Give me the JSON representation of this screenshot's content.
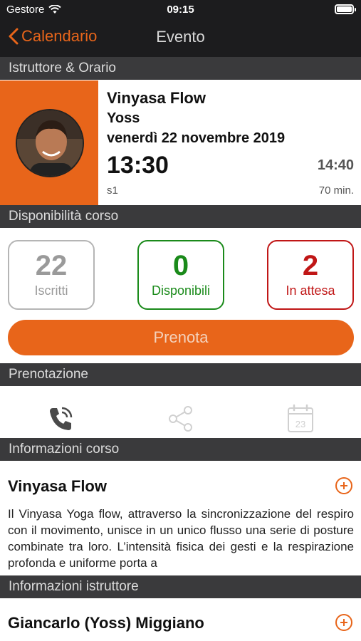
{
  "status_bar": {
    "carrier": "Gestore",
    "time": "09:15"
  },
  "nav": {
    "back_label": "Calendario",
    "title": "Evento"
  },
  "sections": {
    "instructor_schedule": "Istruttore & Orario",
    "availability": "Disponibilità corso",
    "booking": "Prenotazione",
    "course_info": "Informazioni corso",
    "instructor_info": "Informazioni istruttore"
  },
  "event": {
    "course": "Vinyasa Flow",
    "teacher": "Yoss",
    "date": "venerdì 22 novembre 2019",
    "start_time": "13:30",
    "end_time": "14:40",
    "room": "s1",
    "duration": "70 min."
  },
  "availability": {
    "enrolled": {
      "value": "22",
      "label": "Iscritti"
    },
    "available": {
      "value": "0",
      "label": "Disponibili"
    },
    "waiting": {
      "value": "2",
      "label": "In attesa"
    }
  },
  "book_button": "Prenota",
  "booking_actions": [
    {
      "icon": "phone-icon"
    },
    {
      "icon": "share-icon"
    },
    {
      "icon": "calendar-icon",
      "day": "23"
    }
  ],
  "course_info": {
    "title": "Vinyasa Flow",
    "description": "Il  Vinyasa Yoga flow, attraverso la sincronizzazione del respiro con il movimento, unisce in un unico flusso una serie di posture combinate tra loro. L’intensità  fisica dei gesti e la respirazione profonda e uniforme porta a"
  },
  "instructor_info": {
    "name": "Giancarlo (Yoss) Miggiano"
  },
  "colors": {
    "accent": "#e8651a",
    "header_bg": "#3a3a3c",
    "available": "#1a8a1a",
    "waiting": "#c01616"
  }
}
